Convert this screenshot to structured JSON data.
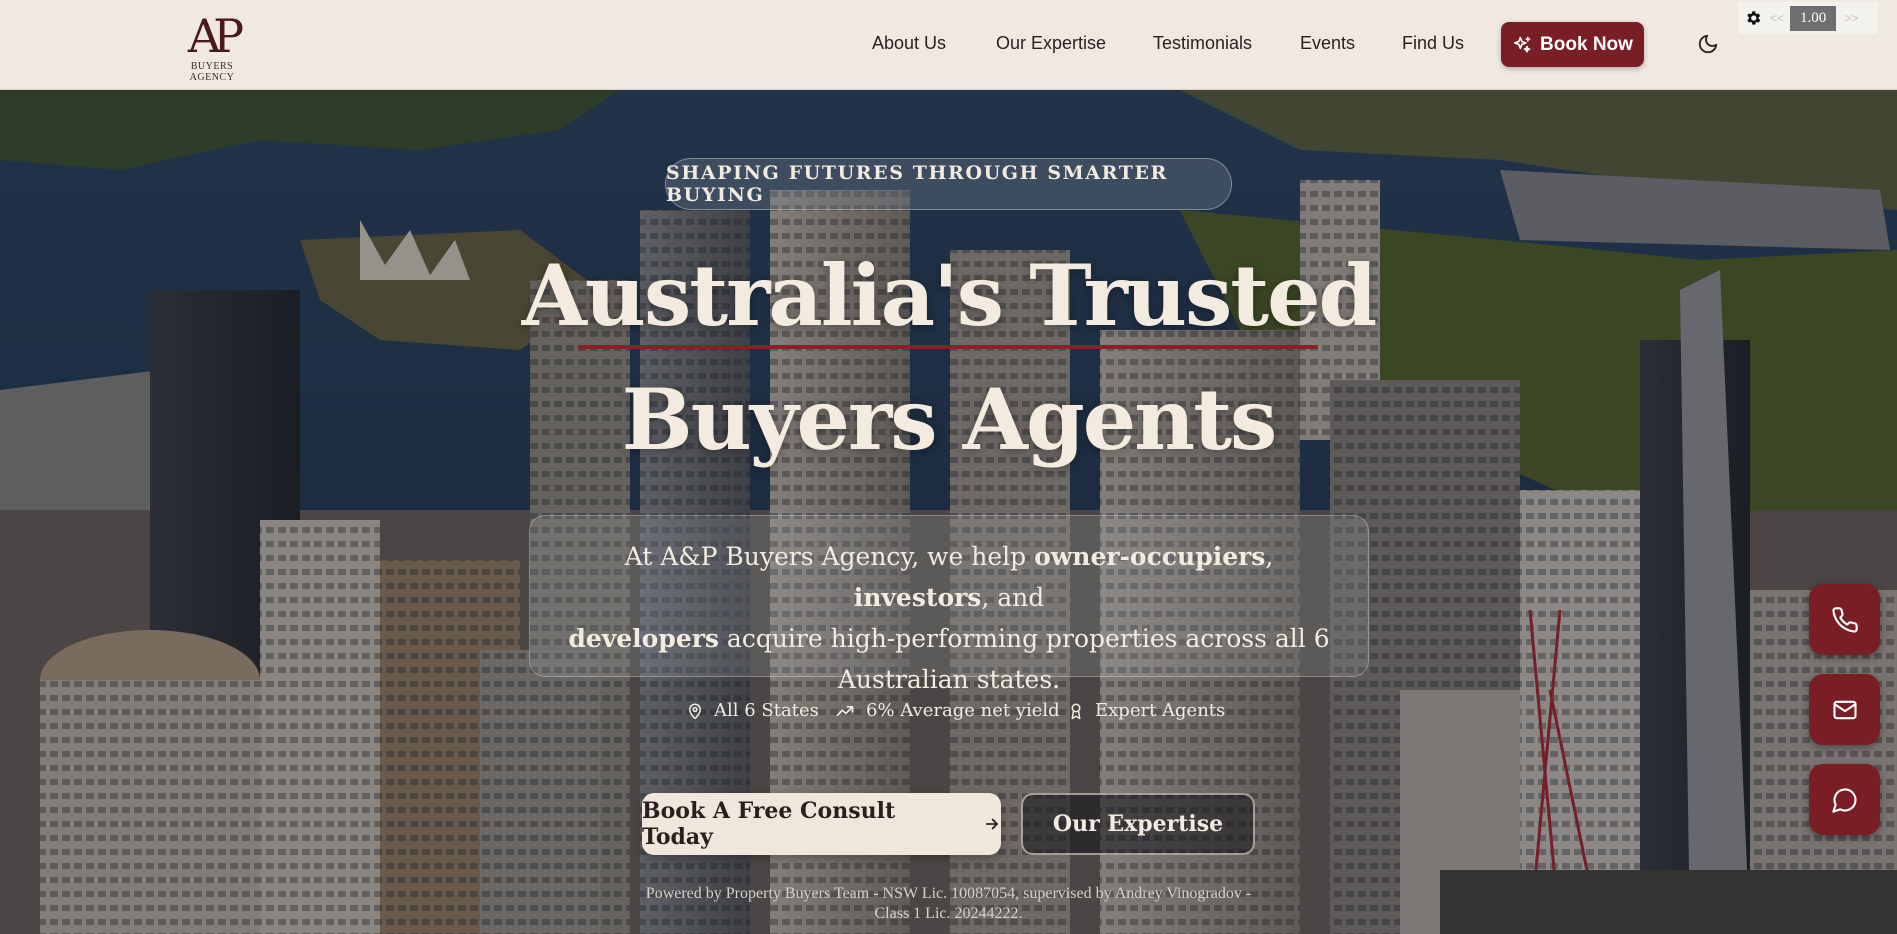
{
  "brand": {
    "logo_mark": "AP",
    "logo_text": "BUYERS AGENCY"
  },
  "nav": {
    "items": [
      {
        "label": "About Us"
      },
      {
        "label": "Our Expertise"
      },
      {
        "label": "Testimonials"
      },
      {
        "label": "Events"
      },
      {
        "label": "Find Us"
      }
    ],
    "book_button": "Book Now"
  },
  "speed_widget": {
    "prev": "<<",
    "value": "1.00",
    "next": ">>"
  },
  "hero": {
    "tagline": "SHAPING FUTURES THROUGH SMARTER BUYING",
    "title_line1": "Australia's Trusted",
    "title_line2": "Buyers Agents",
    "description": {
      "prefix": "At A&P Buyers Agency, we help ",
      "bold1": "owner-occupiers",
      "sep1": ", ",
      "bold2": "investors",
      "sep2": ", and",
      "bold3": "developers",
      "suffix": " acquire high-performing properties across all 6 Australian states."
    },
    "features": [
      {
        "icon": "map-pin-icon",
        "label": "All 6 States"
      },
      {
        "icon": "trending-up-icon",
        "label": "6% Average net yield"
      },
      {
        "icon": "award-icon",
        "label": "Expert Agents"
      }
    ],
    "cta_primary": "Book A Free Consult Today",
    "cta_secondary": "Our Expertise",
    "license_text": "Powered by Property Buyers Team - NSW Lic. 10087054, supervised by Andrey Vinogradov - Class 1 Lic. 20244222."
  },
  "colors": {
    "brand_maroon": "#7a1e25",
    "header_bg": "#efe9e2",
    "hero_text": "#f3ebdf"
  }
}
